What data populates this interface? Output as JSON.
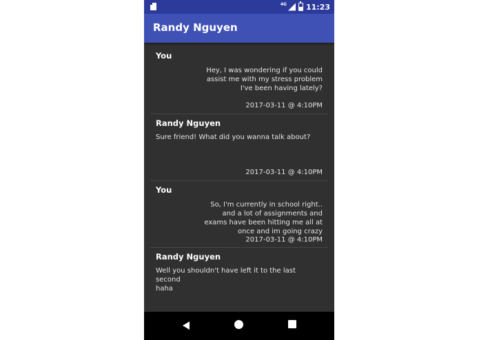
{
  "status_bar": {
    "network_label": "4G",
    "time": "11:23",
    "icons": [
      "sd-card-icon",
      "signal-icon",
      "battery-icon"
    ]
  },
  "app_bar": {
    "title": "Randy Nguyen"
  },
  "messages": [
    {
      "sender": "You",
      "lines": [
        "Hey, I was wondering if you could",
        "assist me with my stress problem",
        "I've been having lately?"
      ],
      "timestamp": "2017-03-11 @ 4:10PM",
      "align": "right"
    },
    {
      "sender": "Randy Nguyen",
      "lines": [
        "Sure friend! What did you wanna talk about?"
      ],
      "timestamp": "2017-03-11 @ 4:10PM",
      "align": "left"
    },
    {
      "sender": "You",
      "lines": [
        "So, I'm currently in school right..",
        "and a lot of assignments and",
        "exams have been hitting me all at",
        "once and im going crazy"
      ],
      "timestamp": "2017-03-11 @ 4:10PM",
      "align": "right"
    },
    {
      "sender": "Randy Nguyen",
      "lines": [
        "Well you shouldn't have left it to the last second",
        "haha"
      ],
      "timestamp": "",
      "align": "left"
    }
  ],
  "nav_bar": {
    "icons": [
      "back-icon",
      "home-icon",
      "recents-icon"
    ]
  },
  "colors": {
    "status_bar": "#2c3a9c",
    "app_bar": "#3f51b5",
    "background": "#303030",
    "nav_bar": "#000000"
  }
}
